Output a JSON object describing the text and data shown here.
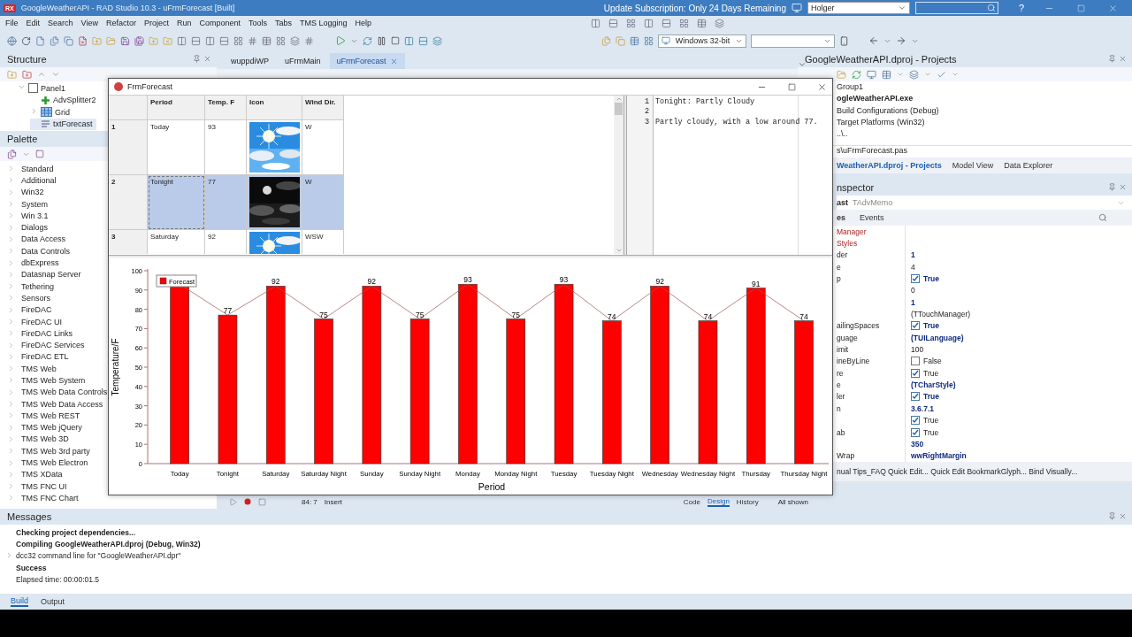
{
  "title_bar": {
    "logo": "RX",
    "title": "GoogleWeatherAPI - RAD Studio 10.3 - uFrmForecast [Built]",
    "notice": "Update Subscription: Only 24 Days Remaining",
    "layout": "Holger",
    "help": "?"
  },
  "menu": [
    "File",
    "Edit",
    "Search",
    "View",
    "Refactor",
    "Project",
    "Run",
    "Component",
    "Tools",
    "Tabs",
    "TMS Logging",
    "Help"
  ],
  "toolbar": {
    "platform": "Windows 32-bit"
  },
  "structure": {
    "title": "Structure",
    "tree": [
      {
        "label": "Panel1",
        "kind": "panel",
        "expanded": true,
        "selected": false,
        "children": [
          {
            "label": "AdvSplitter2",
            "kind": "splitter",
            "selected": false
          },
          {
            "label": "Grid",
            "kind": "grid",
            "expanded": false,
            "selected": false
          },
          {
            "label": "txtForecast",
            "kind": "memo",
            "selected": true
          }
        ]
      }
    ]
  },
  "palette": {
    "title": "Palette",
    "categories": [
      "Standard",
      "Additional",
      "Win32",
      "System",
      "Win 3.1",
      "Dialogs",
      "Data Access",
      "Data Controls",
      "dbExpress",
      "Datasnap Server",
      "Tethering",
      "Sensors",
      "FireDAC",
      "FireDAC UI",
      "FireDAC Links",
      "FireDAC Services",
      "FireDAC ETL",
      "TMS Web",
      "TMS Web System",
      "TMS Web Data Controls",
      "TMS Web Data Access",
      "TMS Web REST",
      "TMS Web jQuery",
      "TMS Web 3D",
      "TMS Web 3rd party",
      "TMS Web Electron",
      "TMS XData",
      "TMS FNC UI",
      "TMS FNC Chart"
    ]
  },
  "editor": {
    "tabs": [
      {
        "label": "wuppdiWP",
        "selected": false
      },
      {
        "label": "uFrmMain",
        "selected": false
      },
      {
        "label": "uFrmForecast",
        "selected": true
      }
    ],
    "status": {
      "position": "84: 7",
      "mode": "Insert",
      "views": [
        {
          "label": "Code",
          "selected": false
        },
        {
          "label": "Design",
          "selected": true
        },
        {
          "label": "History",
          "selected": false
        }
      ],
      "filter": "All shown"
    }
  },
  "form": {
    "title": "FrmForecast",
    "grid": {
      "columns": [
        "Period",
        "Temp. F",
        "Icon",
        "Wind Dir."
      ],
      "rows": [
        {
          "number": "1",
          "period": "Today",
          "temp": "93",
          "wind": "W",
          "selected": false,
          "focused": false
        },
        {
          "number": "2",
          "period": "Tonight",
          "temp": "77",
          "wind": "W",
          "selected": true,
          "focused": true
        },
        {
          "number": "3",
          "period": "Saturday",
          "temp": "92",
          "wind": "WSW",
          "selected": false,
          "focused": false
        }
      ]
    },
    "memo": {
      "lines": [
        {
          "number": "1",
          "text": "Tonight: Partly Cloudy"
        },
        {
          "number": "2"
        },
        {
          "number": "3",
          "text": "Partly cloudy, with a low around 77."
        }
      ]
    },
    "chart": {
      "chart_data": {
        "type": "bar",
        "xlabel": "Period",
        "ylabel": "Temperature/F",
        "categories": [
          "Today",
          "Tonight",
          "Saturday",
          "Saturday Night",
          "Sunday",
          "Sunday Night",
          "Monday",
          "Monday Night",
          "Tuesday",
          "Tuesday Night",
          "Wednesday",
          "Wednesday Night",
          "Thursday",
          "Thursday Night"
        ],
        "series": [
          {
            "name": "Forecast",
            "color": "#ff0000",
            "values": [
              93,
              77,
              92,
              75,
              92,
              75,
              93,
              75,
              93,
              74,
              92,
              74,
              91,
              74
            ]
          }
        ],
        "ylim": [
          0,
          100
        ],
        "yticks": [
          0,
          10,
          20,
          30,
          40,
          50,
          60,
          70,
          80,
          90,
          100
        ],
        "value_labels": [
          null,
          "77",
          "92",
          "75",
          "92",
          "75",
          "93",
          "75",
          "93",
          "74",
          "92",
          "74",
          "91",
          "74"
        ]
      }
    }
  },
  "projects": {
    "title": "GoogleWeatherAPI.dproj - Projects",
    "items": [
      {
        "label": "Group1",
        "active": false
      },
      {
        "label": "ogleWeatherAPI.exe",
        "active": true
      },
      {
        "label": "Build Configurations (Debug)",
        "active": false
      },
      {
        "label": "Target Platforms (Win32)",
        "active": false
      },
      {
        "label": "..\\..",
        "active": false
      }
    ],
    "path": "s\\uFrmForecast.pas",
    "tabs": [
      {
        "label": "WeatherAPI.dproj - Projects",
        "selected": true
      },
      {
        "label": "Model View",
        "selected": false
      },
      {
        "label": "Data Explorer",
        "selected": false
      }
    ]
  },
  "inspector": {
    "title": "nspector",
    "object": "ast",
    "object_type": "TAdvMemo",
    "tabs": [
      {
        "label": "es",
        "selected": true
      },
      {
        "label": "Events",
        "selected": false
      }
    ],
    "rows": [
      {
        "kind": "reference",
        "name": "Manager"
      },
      {
        "kind": "reference",
        "name": "Styles"
      },
      {
        "kind": "text",
        "name": "der",
        "value": "1",
        "modified": true
      },
      {
        "kind": "text",
        "name": "e",
        "value": "4",
        "modified": false
      },
      {
        "kind": "checkbox",
        "name": "p",
        "value": "True",
        "checked": true,
        "modified": true
      },
      {
        "kind": "text",
        "value": "0",
        "modified": false
      },
      {
        "kind": "text",
        "value": "1",
        "modified": true
      },
      {
        "kind": "text",
        "value": "(TTouchManager)",
        "modified": false
      },
      {
        "kind": "checkbox",
        "name": "ailingSpaces",
        "value": "True",
        "checked": true,
        "modified": true
      },
      {
        "kind": "text",
        "name": "guage",
        "value": "(TUILanguage)",
        "modified": true
      },
      {
        "kind": "text",
        "name": "imit",
        "value": "100",
        "modified": false
      },
      {
        "kind": "checkbox",
        "name": "ineByLine",
        "value": "False",
        "checked": false,
        "modified": false
      },
      {
        "kind": "checkbox",
        "name": "re",
        "value": "True",
        "checked": true,
        "modified": false
      },
      {
        "kind": "text",
        "name": "e",
        "value": "(TCharStyle)",
        "modified": true
      },
      {
        "kind": "checkbox",
        "name": "ler",
        "value": "True",
        "checked": true,
        "modified": true
      },
      {
        "kind": "text",
        "name": "n",
        "value": "3.6.7.1",
        "modified": true
      },
      {
        "kind": "checkbox",
        "value": "True",
        "checked": true,
        "modified": false
      },
      {
        "kind": "checkbox",
        "name": "ab",
        "value": "True",
        "checked": true,
        "modified": false
      },
      {
        "kind": "text",
        "value": "350",
        "modified": true
      },
      {
        "kind": "text",
        "name": "Wrap",
        "value": "wwRightMargin",
        "modified": true
      }
    ],
    "actions": "nual Tips_FAQ Quick Edit... Quick Edit BookmarkGlyph... Bind Visually..."
  },
  "messages": {
    "title": "Messages",
    "lines": [
      {
        "text": "Checking project dependencies...",
        "bold": true,
        "expandable": false
      },
      {
        "text": "Compiling GoogleWeatherAPI.dproj (Debug, Win32)",
        "bold": true,
        "expandable": false
      },
      {
        "text": "dcc32 command line for \"GoogleWeatherAPI.dpr\"",
        "bold": false,
        "expandable": true
      },
      {
        "text": "Success",
        "bold": true,
        "expandable": false
      },
      {
        "text": "Elapsed time: 00:00:01.5",
        "bold": false,
        "expandable": false
      }
    ],
    "tabs": [
      {
        "label": "Build",
        "selected": true
      },
      {
        "label": "Output",
        "selected": false
      }
    ]
  }
}
